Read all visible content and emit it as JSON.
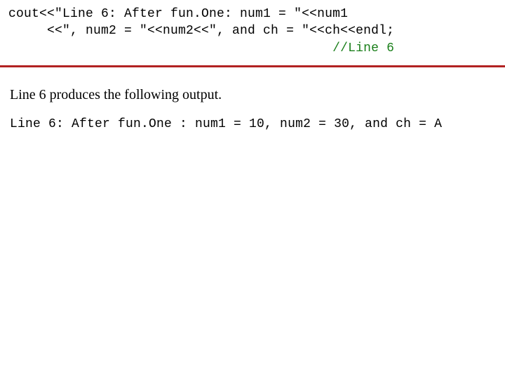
{
  "code": {
    "line1": "cout<<\"Line 6: After fun.One: num1 = \"<<num1",
    "line2": "     <<\", num2 = \"<<num2<<\", and ch = \"<<ch<<endl;",
    "line3_pad": "                                          ",
    "line3_comment": "//Line 6"
  },
  "prose": {
    "text": "Line 6 produces the following output."
  },
  "output": {
    "line": "Line 6: After fun.One : num1 = 10, num2 = 30, and ch = A"
  }
}
